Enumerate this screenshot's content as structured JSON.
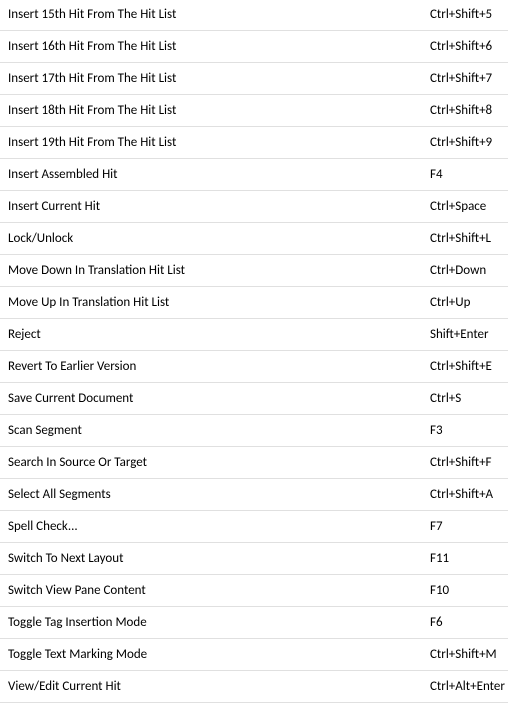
{
  "shortcuts": [
    {
      "command": "Insert 15th Hit From The Hit List",
      "key": "Ctrl+Shift+5"
    },
    {
      "command": "Insert 16th Hit From The Hit List",
      "key": "Ctrl+Shift+6"
    },
    {
      "command": "Insert 17th Hit From The Hit List",
      "key": "Ctrl+Shift+7"
    },
    {
      "command": "Insert 18th Hit From The Hit List",
      "key": "Ctrl+Shift+8"
    },
    {
      "command": "Insert 19th Hit From The Hit List",
      "key": "Ctrl+Shift+9"
    },
    {
      "command": "Insert Assembled Hit",
      "key": "F4"
    },
    {
      "command": "Insert Current Hit",
      "key": "Ctrl+Space"
    },
    {
      "command": "Lock/Unlock",
      "key": "Ctrl+Shift+L"
    },
    {
      "command": "Move Down In Translation Hit List",
      "key": "Ctrl+Down"
    },
    {
      "command": "Move Up In Translation Hit List",
      "key": "Ctrl+Up"
    },
    {
      "command": "Reject",
      "key": "Shift+Enter"
    },
    {
      "command": "Revert To Earlier Version",
      "key": "Ctrl+Shift+E"
    },
    {
      "command": "Save Current Document",
      "key": "Ctrl+S"
    },
    {
      "command": "Scan Segment",
      "key": "F3"
    },
    {
      "command": "Search In Source Or Target",
      "key": "Ctrl+Shift+F"
    },
    {
      "command": "Select All Segments",
      "key": "Ctrl+Shift+A"
    },
    {
      "command": "Spell Check...",
      "key": "F7"
    },
    {
      "command": "Switch To Next Layout",
      "key": "F11"
    },
    {
      "command": "Switch View Pane Content",
      "key": "F10"
    },
    {
      "command": "Toggle Tag Insertion Mode",
      "key": "F6"
    },
    {
      "command": "Toggle Text Marking Mode",
      "key": "Ctrl+Shift+M"
    },
    {
      "command": "View/Edit Current Hit",
      "key": "Ctrl+Alt+Enter"
    }
  ]
}
